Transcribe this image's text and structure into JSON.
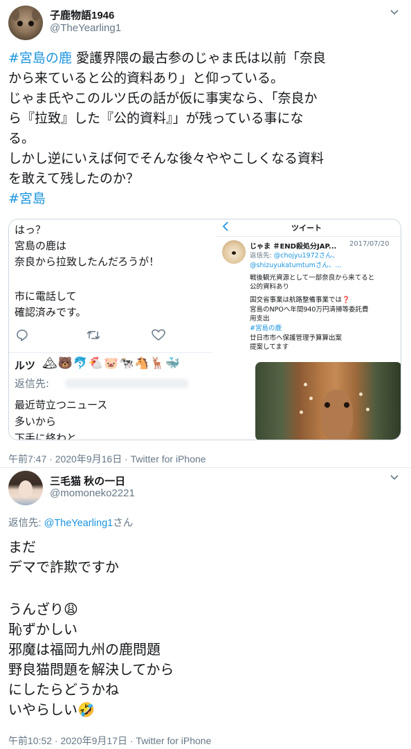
{
  "tweet1": {
    "display_name": "子鹿物語1946",
    "handle": "@TheYearling1",
    "body": {
      "hashtag1": "#宮島の鹿",
      "line1": " 愛護界隈の最古参のじゃま氏は以前「奈良",
      "line2": "から来ていると公的資料あり」と仰っている。",
      "line3": "じゃま氏やこのルツ氏の話が仮に事実なら、「奈良か",
      "line4": "ら『拉致』した『公的資料』」が残っている事にな",
      "line5": "る。",
      "line6": "しかし逆にいえば何でそんな後々ややこしくなる資料",
      "line7": "を敢えて残したのか？",
      "hashtag2": "#宮島"
    },
    "embed": {
      "left": {
        "lines": [
          "はっ？",
          "宮島の鹿は",
          "奈良から拉致したんだろうが！",
          "",
          "市に電話して",
          "確認済みです。"
        ],
        "reply_icon": "reply-icon",
        "retweet_icon": "retweet-icon",
        "like_icon": "heart-icon",
        "name": "ルツ",
        "emojis": "🏔🐻🐬🐔🐷🐄🐴🦌🐳",
        "reply_to": "返信先:",
        "lines2": [
          "最近苛立つニュース",
          "多いから",
          "下手に終わと"
        ]
      },
      "right": {
        "back_icon": "chevron-left-icon",
        "title": "ツイート",
        "name": "じゃま ＃END殺処分JAP...",
        "date": "2017/07/20",
        "reply_prefix": "返信先: ",
        "reply_link1": "@chojyu1972さん、",
        "reply_link2": "@shizuyukatumtumさん、...",
        "text_lines": [
          "戦後観光資源として一部奈良から来てると",
          "公的資料あり",
          "国交省事業は航路整備事業では❓",
          "宮島のNPOへ年間940万円清掃等委託費",
          "用支出"
        ],
        "hashtag": "#宮島の鹿",
        "text_lines2": [
          "廿日市市へ保護管理予算算出案",
          "提案してます"
        ]
      }
    },
    "meta": "午前7:47 · 2020年9月16日 · Twitter for iPhone"
  },
  "tweet2": {
    "display_name": "三毛猫 秋の一日",
    "handle": "@momoneko2221",
    "reply_prefix": "返信先: ",
    "reply_link": "@TheYearling1",
    "reply_suffix": "さん",
    "lines": [
      "まだ",
      "デマで詐欺ですか",
      "",
      "うんざり😩",
      "恥ずかしい",
      "邪魔は福岡九州の鹿問題",
      "野良猫問題を解決してから",
      "にしたらどうかね",
      "いやらしい🤣"
    ],
    "meta": "午前10:52 · 2020年9月17日 · Twitter for iPhone"
  },
  "colors": {
    "link": "#1b95e0",
    "secondary": "#657786",
    "text": "#14171a",
    "border": "#ccd6dd"
  }
}
